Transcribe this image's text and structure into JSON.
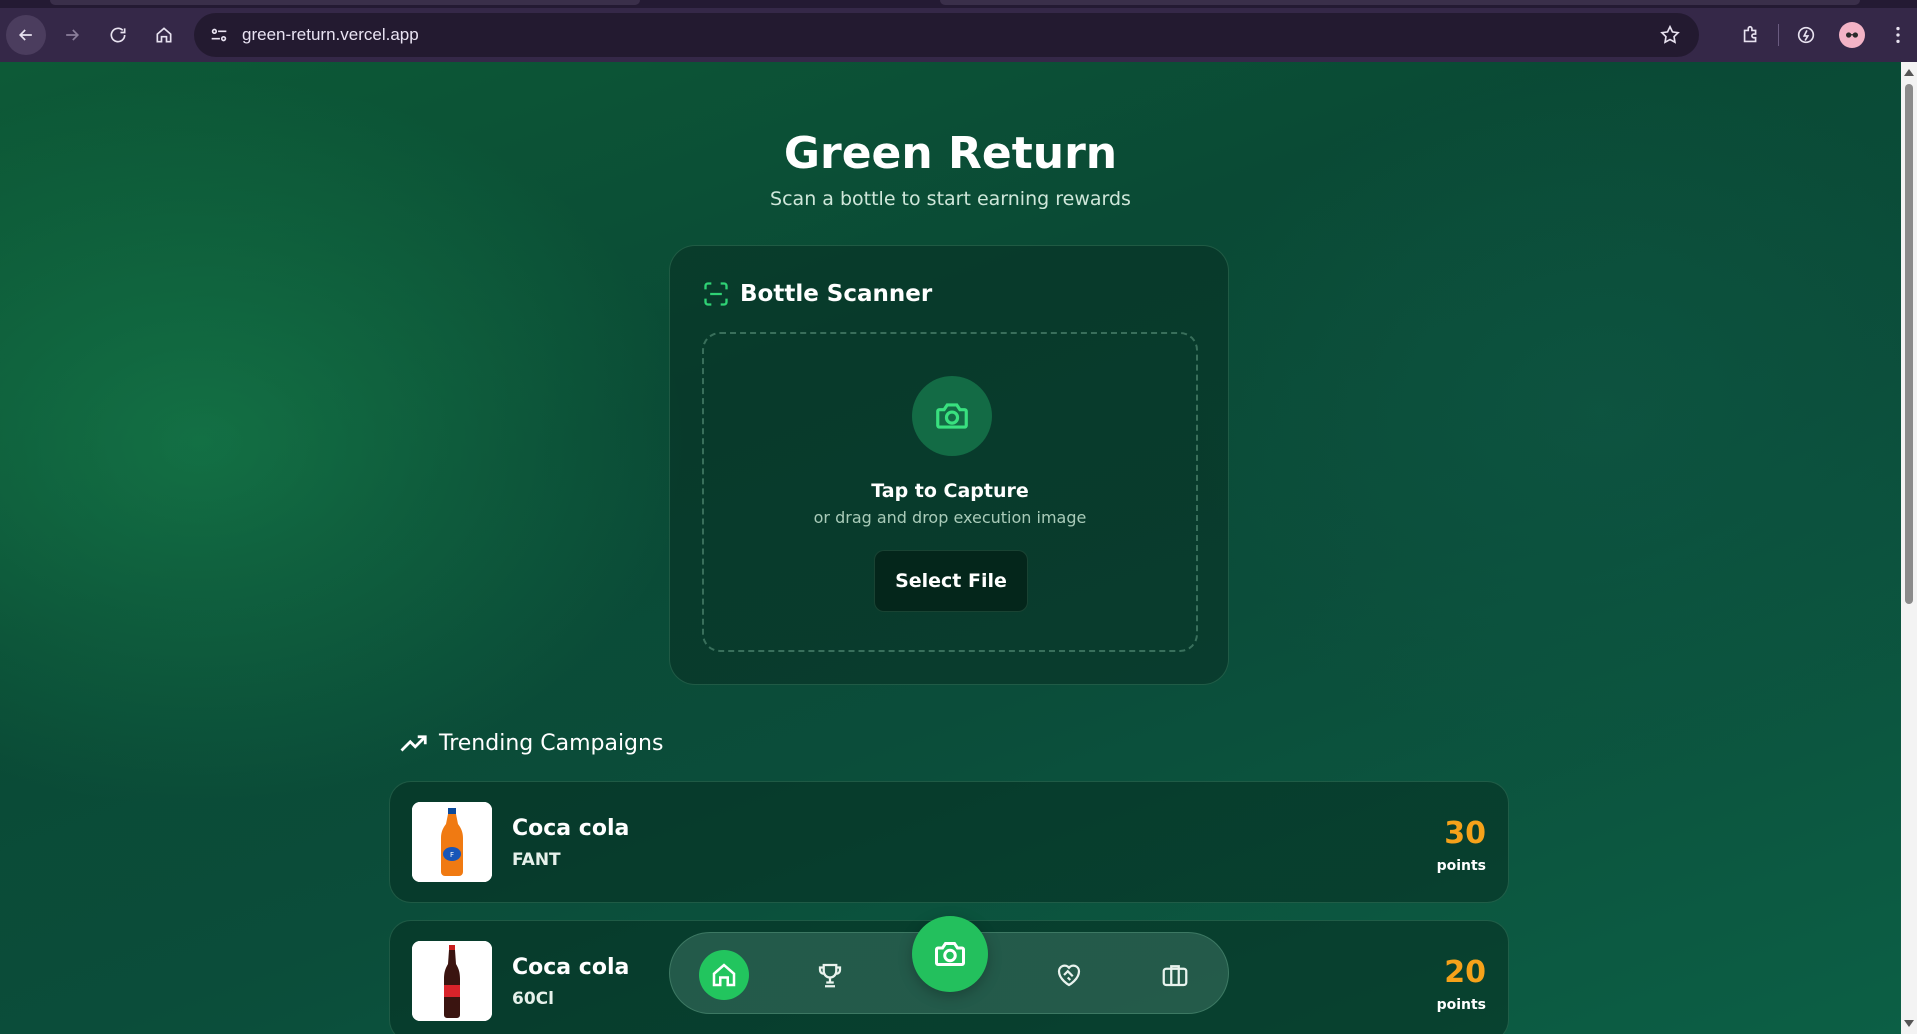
{
  "browser": {
    "url": "green-return.vercel.app"
  },
  "page": {
    "title": "Green Return",
    "subtitle": "Scan a bottle to start earning rewards"
  },
  "scanner": {
    "title": "Bottle Scanner",
    "tap_label": "Tap to Capture",
    "drag_label": "or drag and drop execution image",
    "select_button": "Select File"
  },
  "trending": {
    "title": "Trending Campaigns",
    "campaigns": [
      {
        "name": "Coca cola",
        "variant": "FANT",
        "points": "30",
        "points_label": "points",
        "image": "orange-soda-bottle"
      },
      {
        "name": "Coca cola",
        "variant": "60Cl",
        "points": "20",
        "points_label": "points",
        "image": "cola-bottle"
      }
    ]
  },
  "bottom_nav": {
    "items": [
      "home-icon",
      "trophy-icon",
      "camera-icon",
      "heart-handshake-icon",
      "briefcase-icon"
    ],
    "active": "home"
  },
  "colors": {
    "accent_green": "#22c55e",
    "points_orange": "#f6a21a",
    "browser_chrome": "#352848"
  }
}
